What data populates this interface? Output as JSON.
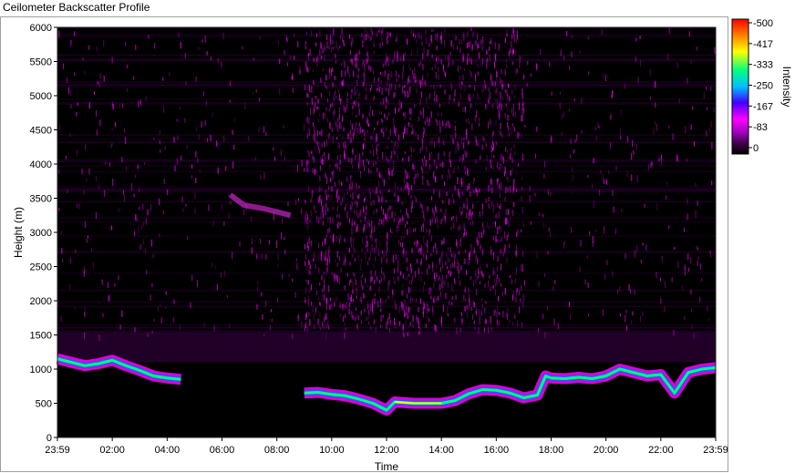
{
  "window": {
    "title": "Ceilometer Backscatter Profile"
  },
  "chart_data": {
    "type": "heatmap",
    "title": "Ceilometer Backscatter Profile",
    "xlabel": "Time",
    "ylabel": "Height (m)",
    "x_ticks": [
      "23:59",
      "02:00",
      "04:00",
      "06:00",
      "08:00",
      "10:00",
      "12:00",
      "14:00",
      "16:00",
      "18:00",
      "20:00",
      "22:00",
      "23:59"
    ],
    "x_range_hours": [
      0,
      24
    ],
    "y_ticks": [
      0,
      500,
      1000,
      1500,
      2000,
      2500,
      3000,
      3500,
      4000,
      4500,
      5000,
      5500,
      6000
    ],
    "ylim": [
      0,
      6000
    ],
    "colorbar": {
      "label": "Intensity",
      "range": [
        0,
        500
      ],
      "ticks": [
        -500,
        -417,
        -333,
        -250,
        -167,
        -83,
        0
      ],
      "colors": [
        "#000000",
        "#8000a0",
        "#ff00ff",
        "#0000ff",
        "#00c0ff",
        "#00ff80",
        "#ffff00",
        "#ff8000",
        "#ff0000"
      ]
    },
    "cloud_base_layer": {
      "name": "",
      "points": [
        [
          0.0,
          1150
        ],
        [
          0.5,
          1100
        ],
        [
          1.0,
          1050
        ],
        [
          1.5,
          1080
        ],
        [
          2.0,
          1130
        ],
        [
          2.5,
          1050
        ],
        [
          3.0,
          980
        ],
        [
          3.5,
          900
        ],
        [
          4.0,
          870
        ],
        [
          4.5,
          850
        ],
        [
          9.0,
          650
        ],
        [
          9.5,
          660
        ],
        [
          10.0,
          630
        ],
        [
          10.5,
          610
        ],
        [
          11.0,
          560
        ],
        [
          11.5,
          500
        ],
        [
          12.0,
          400
        ],
        [
          12.3,
          520
        ],
        [
          13.0,
          500
        ],
        [
          14.0,
          500
        ],
        [
          14.5,
          540
        ],
        [
          15.0,
          640
        ],
        [
          15.5,
          700
        ],
        [
          16.0,
          690
        ],
        [
          16.5,
          650
        ],
        [
          17.0,
          580
        ],
        [
          17.5,
          620
        ],
        [
          17.8,
          900
        ],
        [
          18.0,
          870
        ],
        [
          18.5,
          860
        ],
        [
          19.0,
          880
        ],
        [
          19.5,
          860
        ],
        [
          20.0,
          900
        ],
        [
          20.5,
          1000
        ],
        [
          21.0,
          950
        ],
        [
          21.5,
          900
        ],
        [
          22.0,
          920
        ],
        [
          22.5,
          650
        ],
        [
          23.0,
          950
        ],
        [
          23.5,
          1000
        ],
        [
          24.0,
          1020
        ]
      ]
    },
    "upper_layer": {
      "name": "",
      "points": [
        [
          6.3,
          3550
        ],
        [
          6.8,
          3400
        ],
        [
          7.5,
          3350
        ],
        [
          8.0,
          3300
        ],
        [
          8.5,
          3250
        ]
      ]
    },
    "boundary_layer_top_m": 1550,
    "scatter_region": {
      "x_hours": [
        9,
        17
      ],
      "y_m": [
        1600,
        6000
      ]
    }
  }
}
